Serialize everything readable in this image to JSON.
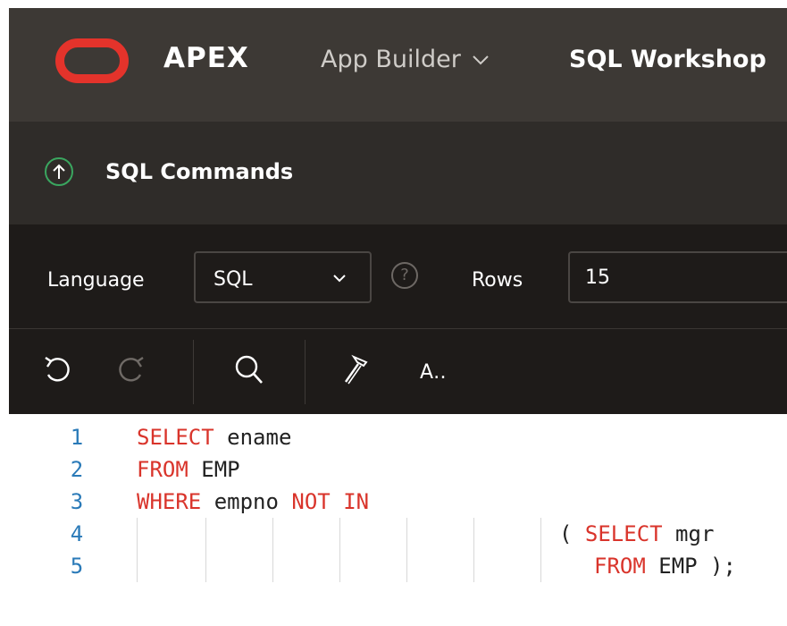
{
  "header": {
    "brand": "APEX",
    "nav": [
      {
        "label": "App Builder",
        "has_dropdown": true
      },
      {
        "label": "SQL Workshop",
        "active": true
      }
    ],
    "logo_color": "#e4332b"
  },
  "page": {
    "title": "SQL Commands",
    "back_icon": "arrow-up-circle-icon"
  },
  "options": {
    "language_label": "Language",
    "language_value": "SQL",
    "help_symbol": "?",
    "rows_label": "Rows",
    "rows_value": "15"
  },
  "toolbar": {
    "icons": [
      "undo-icon",
      "redo-icon",
      "search-icon",
      "hammer-icon",
      "autocomplete-icon"
    ],
    "autocomplete_label": "A‥"
  },
  "editor": {
    "lines": [
      {
        "number": "1",
        "tokens": [
          {
            "t": "SELECT",
            "kw": true
          },
          {
            "t": " ename"
          }
        ]
      },
      {
        "number": "2",
        "tokens": [
          {
            "t": "FROM",
            "kw": true
          },
          {
            "t": " EMP"
          }
        ]
      },
      {
        "number": "3",
        "tokens": [
          {
            "t": "WHERE",
            "kw": true
          },
          {
            "t": " empno "
          },
          {
            "t": "NOT",
            "kw": true
          },
          {
            "t": " "
          },
          {
            "t": "IN",
            "kw": true
          }
        ]
      },
      {
        "number": "4",
        "tokens": [
          {
            "t": "( "
          },
          {
            "t": "SELECT",
            "kw": true
          },
          {
            "t": " mgr"
          }
        ]
      },
      {
        "number": "5",
        "tokens": [
          {
            "t": "FROM",
            "kw": true
          },
          {
            "t": " EMP );"
          }
        ]
      }
    ],
    "keyword_color": "#d9342b",
    "line_number_color": "#2a7ab8"
  }
}
